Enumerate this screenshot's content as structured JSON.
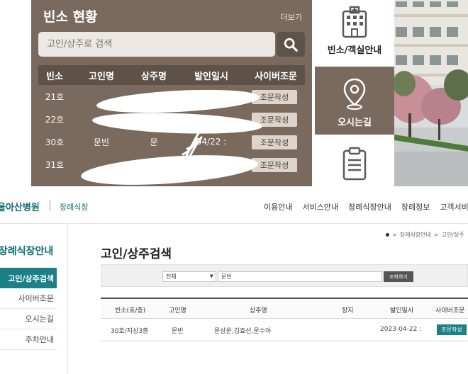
{
  "top_panel": {
    "title": "빈소 현황",
    "more_label": "더보기",
    "search_placeholder": "고인/상주로 검색",
    "columns": [
      "빈소",
      "고인명",
      "상주명",
      "발인일시",
      "사이버조문"
    ],
    "rows": [
      {
        "room": "21호",
        "deceased": "",
        "mourner": "",
        "date": "",
        "button": "조문작성"
      },
      {
        "room": "22호",
        "deceased": "",
        "mourner": "",
        "date": "",
        "button": "조문작성"
      },
      {
        "room": "30호",
        "deceased": "문빈",
        "mourner": "문",
        "date": "04/22 :",
        "button": "조문작성"
      },
      {
        "room": "31호",
        "deceased": "",
        "mourner": "",
        "date": "",
        "button": "조문작성"
      }
    ]
  },
  "right_menu": {
    "room_label": "빈소/객실안내",
    "directions_label": "오시는길"
  },
  "site": {
    "logo": "울아산병원",
    "logo_sub": "장례식장",
    "nav": [
      "이용안내",
      "서비스안내",
      "장례식장안내",
      "장례정보",
      "고객서비"
    ]
  },
  "sidebar": {
    "title": "장례식장안내",
    "items": [
      "고인/상주검색",
      "사이버조문",
      "오시는길",
      "주차안내"
    ]
  },
  "content": {
    "breadcrumb": [
      "장례식장안내",
      "고인/상주"
    ],
    "page_title": "고인/상주검색",
    "search": {
      "select_value": "전체",
      "input_value": "문빈",
      "submit_label": "조회하기"
    },
    "table": {
      "columns": [
        "빈소(호/층)",
        "고인명",
        "상주명",
        "장지",
        "발인일시",
        "사이버조문"
      ],
      "row": {
        "room": "30호/지상3층",
        "deceased": "문빈",
        "mourners": "문상운,김효선,문수아",
        "burial": "",
        "date": "2023-04-22 :",
        "button": "조문작성"
      }
    }
  },
  "colors": {
    "panel_brown": "#7a6a5e",
    "dark_brown": "#5e5148",
    "teal": "#1b8187",
    "logo_teal": "#0d6e72"
  }
}
